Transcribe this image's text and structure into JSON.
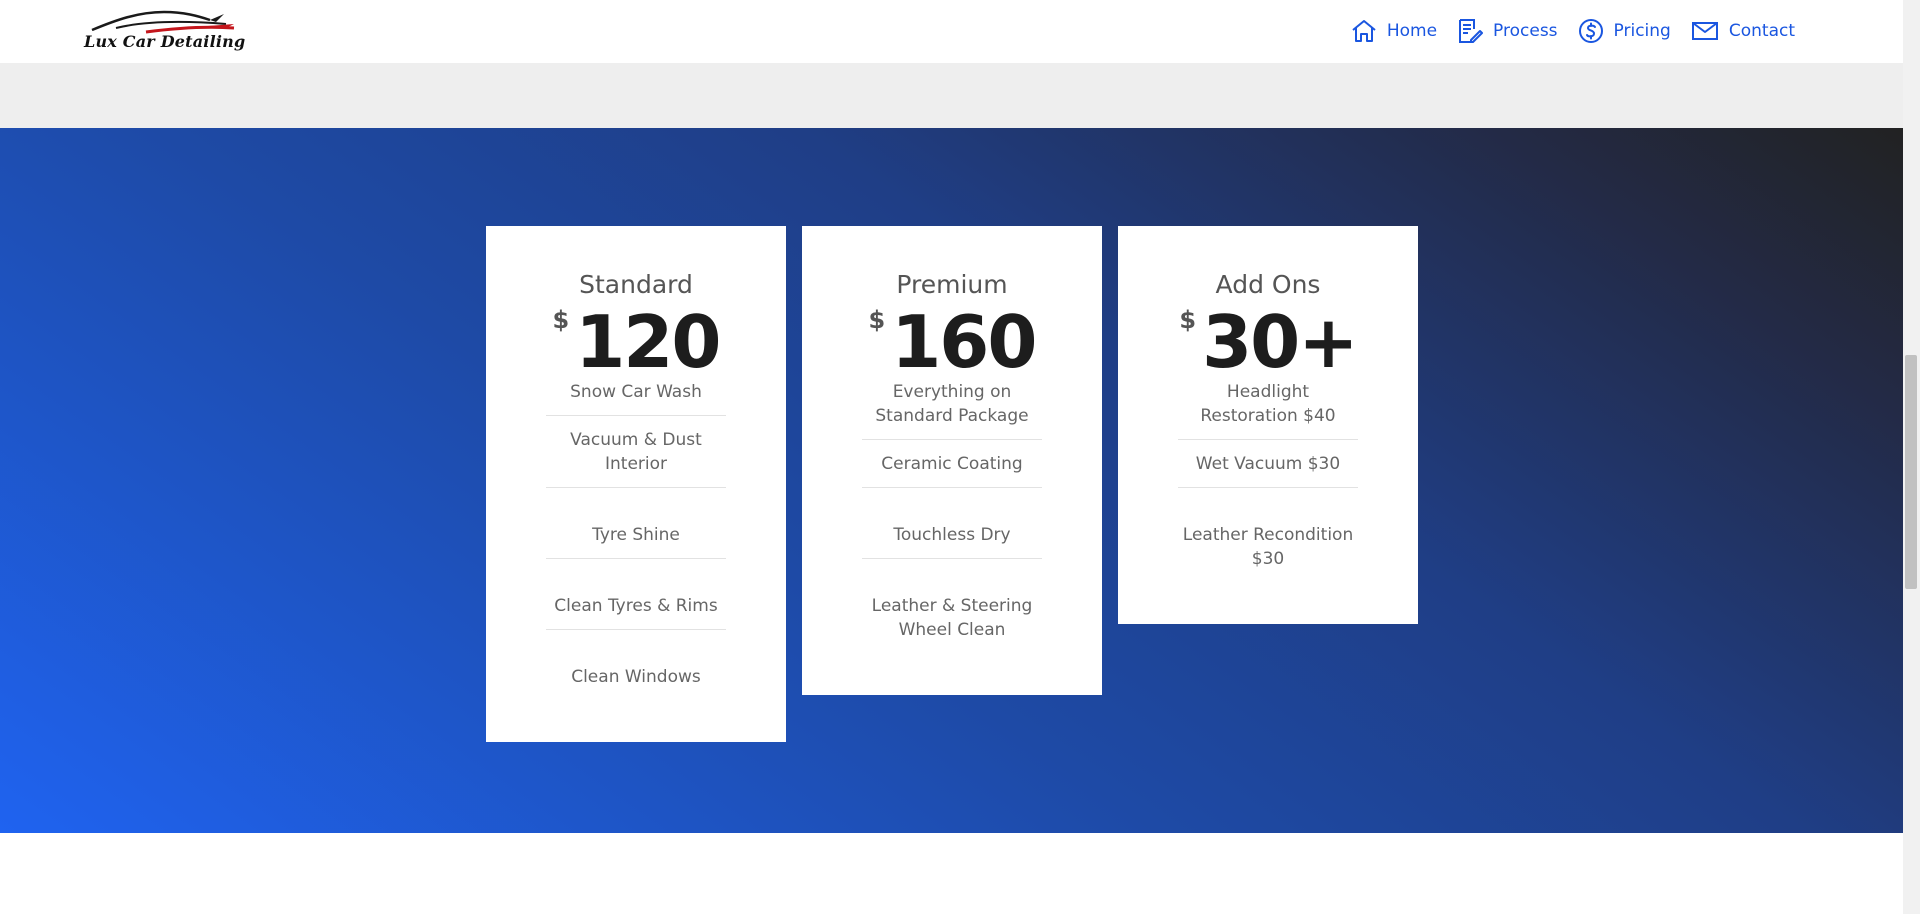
{
  "header": {
    "logo_text": "Lux Car Detailing",
    "nav": [
      {
        "label": "Home",
        "icon": "home-icon"
      },
      {
        "label": "Process",
        "icon": "document-edit-icon"
      },
      {
        "label": "Pricing",
        "icon": "dollar-circle-icon"
      },
      {
        "label": "Contact",
        "icon": "mail-icon"
      }
    ]
  },
  "pricing": {
    "cards": [
      {
        "title": "Standard",
        "currency": "$",
        "price": "120",
        "features": [
          "Snow Car Wash",
          "Vacuum & Dust Interior",
          "Tyre Shine",
          "Clean Tyres & Rims",
          "Clean Windows"
        ]
      },
      {
        "title": "Premium",
        "currency": "$",
        "price": "160",
        "features": [
          "Everything on Standard Package",
          "Ceramic Coating",
          "Touchless Dry",
          "Leather & Steering Wheel Clean"
        ]
      },
      {
        "title": "Add Ons",
        "currency": "$",
        "price": "30+",
        "features": [
          "Headlight Restoration $40",
          "Wet Vacuum $30",
          "Leather Recondition $30"
        ]
      }
    ]
  },
  "colors": {
    "accent": "#1a56e0",
    "gradient_start": "#1f63f0",
    "gradient_end": "#222222"
  }
}
